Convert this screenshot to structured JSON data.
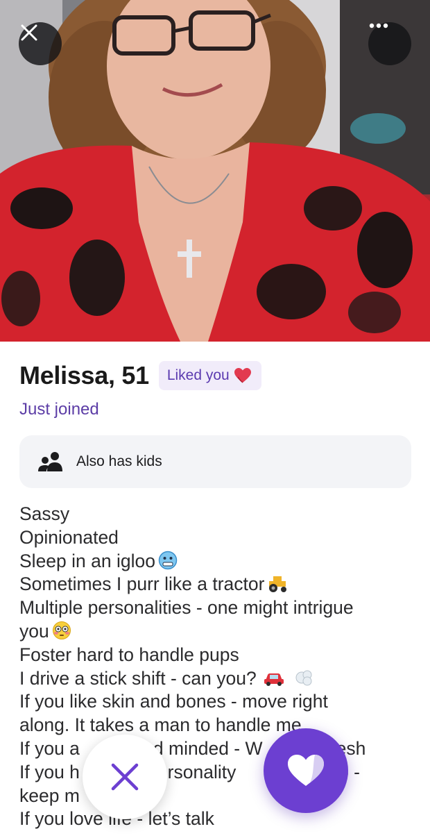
{
  "photo": {
    "alt": "Profile photo",
    "close_icon": "close-icon",
    "more_icon": "more-dots-icon"
  },
  "profile": {
    "name_age": "Melissa, 51",
    "liked_badge": "Liked you",
    "liked_icon": "heart-emoji",
    "status": "Just joined"
  },
  "details": {
    "kids_icon": "people-icon",
    "kids_label": "Also has kids"
  },
  "bio": {
    "lines": [
      "Sassy",
      "Opinionated",
      "Sleep in an igloo",
      "Sometimes I purr like a tractor",
      "Multiple personalities - one might intrigue",
      "you",
      "Foster hard to handle pups",
      "I drive a stick shift - can you?",
      "If you like skin and bones - move right",
      "along. It takes a man to handle me.",
      "If you a",
      "If you h",
      "keep m",
      "If you love life - let’s talk"
    ],
    "line_11_tail": "d minded - W",
    "line_11_end": "mesh",
    "line_12_mid": "ersonality",
    "line_12_end": "op -"
  },
  "actions": {
    "pass_icon": "x-icon",
    "like_icon": "heart-icon",
    "accent": "#6c3fd1"
  }
}
